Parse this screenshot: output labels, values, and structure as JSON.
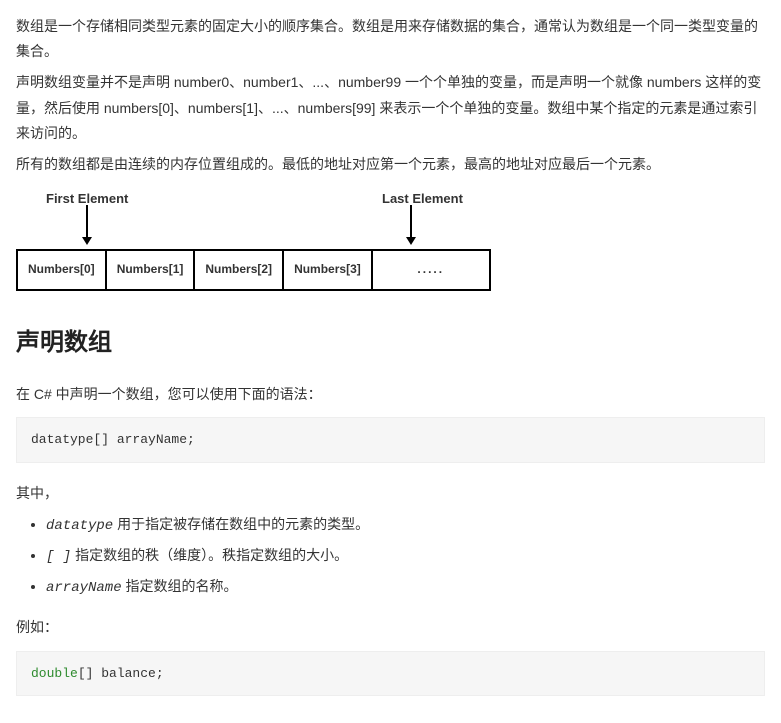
{
  "intro": {
    "p1": "数组是一个存储相同类型元素的固定大小的顺序集合。数组是用来存储数据的集合，通常认为数组是一个同一类型变量的集合。",
    "p2": "声明数组变量并不是声明 number0、number1、...、number99 一个个单独的变量，而是声明一个就像 numbers 这样的变量，然后使用 numbers[0]、numbers[1]、...、numbers[99] 来表示一个个单独的变量。数组中某个指定的元素是通过索引来访问的。",
    "p3": "所有的数组都是由连续的内存位置组成的。最低的地址对应第一个元素，最高的地址对应最后一个元素。"
  },
  "diagram": {
    "first_label": "First Element",
    "last_label": "Last Element",
    "cells": [
      "Numbers[0]",
      "Numbers[1]",
      "Numbers[2]",
      "Numbers[3]",
      "....."
    ]
  },
  "section": {
    "heading": "声明数组",
    "lead": "在 C# 中声明一个数组，您可以使用下面的语法：",
    "code1": "datatype[] arrayName;",
    "where_label": "其中，",
    "bullets": {
      "b1_code": "datatype",
      "b1_text": " 用于指定被存储在数组中的元素的类型。",
      "b2_code": "[ ]",
      "b2_text": " 指定数组的秩（维度）。秩指定数组的大小。",
      "b3_code": "arrayName",
      "b3_text": " 指定数组的名称。"
    },
    "example_label": "例如：",
    "code2_keyword": "double",
    "code2_rest": "[] balance;"
  }
}
